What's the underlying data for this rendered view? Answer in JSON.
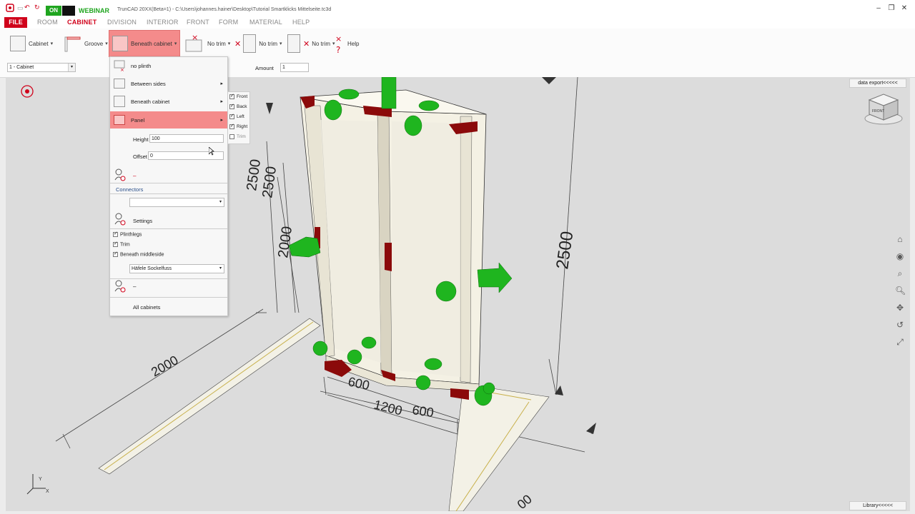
{
  "title_bar": {
    "on_label": "ON",
    "webinar_label": "WEBINAR",
    "window_title": "TrunCAD 20XX(Beta=1) - C:\\Users\\johannes.hainer\\Desktop\\Tutorial Smartklicks Mittelseite.tc3d",
    "minimize": "–",
    "maximize": "❐",
    "close": "✕"
  },
  "menu": {
    "file": "FILE",
    "items": [
      "ROOM",
      "CABINET",
      "DIVISION",
      "INTERIOR",
      "FRONT",
      "FORM",
      "MATERIAL",
      "HELP"
    ],
    "active": "CABINET"
  },
  "toolbar": {
    "cabinet": "Cabinet",
    "groove": "Groove",
    "beneath_cabinet": "Beneath cabinet",
    "no_trim_1": "No trim",
    "no_trim_2": "No trim",
    "no_trim_3": "No trim",
    "help": "Help"
  },
  "subbar": {
    "cabinet_select": "1 - Cabinet",
    "amount_label": "Amount",
    "amount_value": "1",
    "data_export": "data export<<<<<"
  },
  "panel": {
    "no_plinth": "no plinth",
    "between_sides": "Between sides",
    "beneath_cabinet": "Beneath cabinet",
    "panel": "Panel",
    "height_label": "Height",
    "height_value": "100",
    "offset_label": "Offset",
    "offset_value": "0",
    "dash1": "–",
    "connectors": "Connectors",
    "connectors_value": "",
    "settings": "Settings",
    "plinthlegs": "Plinthlegs",
    "trim": "Trim",
    "beneath_middleside": "Beneath middleside",
    "plinth_type": "Häfele Sockelfuss",
    "dash2": "–",
    "all_cabinets": "All cabinets"
  },
  "side_menu": {
    "front": "Front",
    "back": "Back",
    "left": "Left",
    "right": "Right",
    "trim": "Trim"
  },
  "viewport": {
    "dims": [
      "2500",
      "2500",
      "2000",
      "2500",
      "2000",
      "600",
      "1200",
      "600",
      "00"
    ],
    "cube_label": "FRONT",
    "library": "Library<<<<<",
    "axis_y": "Y",
    "axis_x": "X"
  },
  "colors": {
    "accent": "#d0021b",
    "highlight": "#f48b8b",
    "connector_green": "#1fb51f",
    "edge_red": "#8b0a0a",
    "panel_cream": "#f4f1e4"
  }
}
